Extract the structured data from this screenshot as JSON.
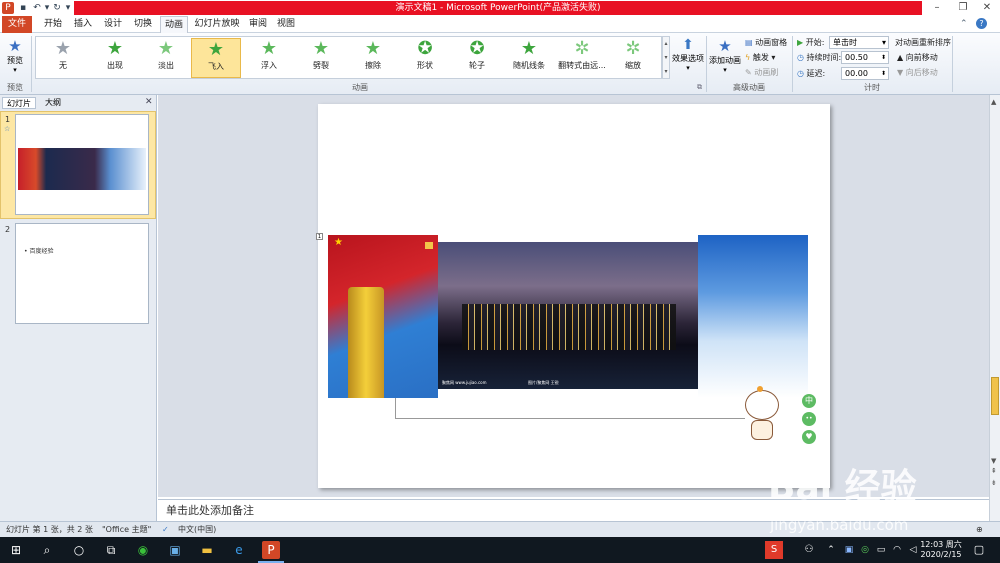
{
  "title_bar": {
    "title": "演示文稿1 - Microsoft PowerPoint(产品激活失败)",
    "win_minimize": "–",
    "win_restore": "❐",
    "win_close": "✕"
  },
  "tabs": [
    "文件",
    "开始",
    "插入",
    "设计",
    "切换",
    "动画",
    "幻灯片放映",
    "审阅",
    "视图"
  ],
  "ribbon": {
    "preview_label": "预览",
    "preview_group": "预览",
    "animation_gallery": [
      "无",
      "出现",
      "淡出",
      "飞入",
      "浮入",
      "劈裂",
      "擦除",
      "形状",
      "轮子",
      "随机线条",
      "翻转式由远...",
      "缩放"
    ],
    "selected_animation": "飞入",
    "effect_options": "效果选项",
    "animation_group": "动画",
    "add_animation": "添加动画",
    "animation_pane": "动画窗格",
    "trigger": "触发",
    "animation_painter": "动画刷",
    "advanced_group": "高级动画",
    "start_label": "开始:",
    "start_value": "单击时",
    "duration_label": "持续时间:",
    "duration_value": "00.50",
    "delay_label": "延迟:",
    "delay_value": "00.00",
    "reorder_label": "对动画重新排序",
    "move_earlier": "向前移动",
    "move_later": "向后移动",
    "timing_group": "计时"
  },
  "left_panel": {
    "tab_slides": "幻灯片",
    "tab_outline": "大纲",
    "close_icon": "✕",
    "slide1_num": "1",
    "slide2_num": "2",
    "slide2_text": "• 百度经验"
  },
  "slide": {
    "photo_caption_left": "聚焦网 www.jujiao.com",
    "photo_caption_mid": "图片/聚焦网 王锐",
    "emoji_zh": "中",
    "emoji_dots": "••"
  },
  "notes_placeholder": "单击此处添加备注",
  "status_bar": {
    "slide_info": "幻灯片 第 1 张，共 2 张",
    "theme": "\"Office 主题\"",
    "language": "中文(中国)"
  },
  "taskbar": {
    "time": "12:03 周六",
    "date": "2020/2/15"
  },
  "watermark": {
    "brand": "Bai  经验",
    "url": "jingyan.baidu.com"
  },
  "colors": {
    "title_red": "#e81123",
    "file_tab": "#d24726",
    "selected_anim": "#fde59a"
  }
}
